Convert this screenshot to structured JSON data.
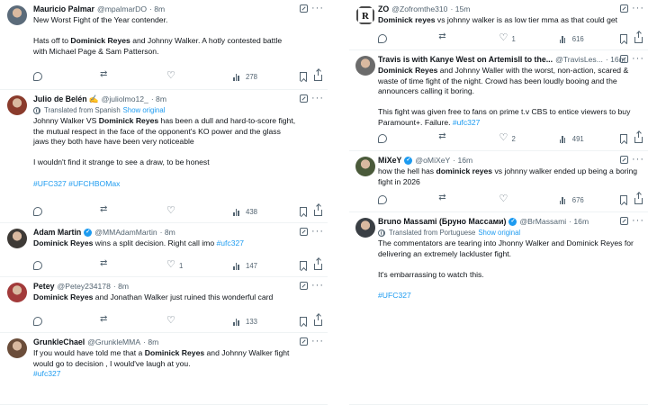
{
  "left": [
    {
      "name": "Mauricio Palmar",
      "handle": "@mpalmarDO",
      "time": "· 8m",
      "text_parts": [
        {
          "line": "New Worst Fight of the Year contender."
        },
        {
          "gap": true
        },
        {
          "segments": [
            {
              "t": "Hats off to "
            },
            {
              "b": "Dominick Reyes"
            },
            {
              "t": " and Johnny Walker. A hotly contested battle"
            }
          ]
        },
        {
          "line": "with Michael Page & Sam Patterson."
        }
      ],
      "views": "278"
    },
    {
      "name": "Julio de Belén",
      "name_emoji": "✍️",
      "handle": "@juliolmo12_",
      "time": "· 8m",
      "translated": "Translated from Spanish",
      "show_original": "Show original",
      "text_parts": [
        {
          "segments": [
            {
              "t": "Johnny Walker VS "
            },
            {
              "b": "Dominick Reyes"
            },
            {
              "t": " has been a dull and hard-to-score fight,"
            }
          ]
        },
        {
          "line": "the mutual respect in the face of the opponent's KO power and the glass"
        },
        {
          "line": "jaws they both have have been very noticeable"
        },
        {
          "gap": true
        },
        {
          "line": "I wouldn't find it strange to see a draw, to be honest"
        },
        {
          "gap": true
        },
        {
          "tags": "#UFC327 #UFCHBOMax"
        }
      ],
      "views": "438"
    },
    {
      "name": "Adam Martin",
      "verified": true,
      "handle": "@MMAdamMartin",
      "time": "· 8m",
      "text_parts": [
        {
          "segments": [
            {
              "b": "Dominick Reyes"
            },
            {
              "t": " wins a split decision. Right call imo "
            },
            {
              "tag": "#ufc327"
            }
          ]
        }
      ],
      "likes": "1",
      "views": "147"
    },
    {
      "name": "Petey",
      "handle": "@Petey234178",
      "time": "· 8m",
      "text_parts": [
        {
          "segments": [
            {
              "b": "Dominick Reyes"
            },
            {
              "t": " and Jonathan Walker just ruined this wonderful card"
            }
          ]
        }
      ],
      "views": "133"
    },
    {
      "name": "GrunkleChael",
      "handle": "@GrunkleMMA",
      "time": "· 8m",
      "text_parts": [
        {
          "segments": [
            {
              "t": "If you would have told me that a "
            },
            {
              "b": "Dominick Reyes"
            },
            {
              "t": " and Johnny Walker fight"
            }
          ]
        },
        {
          "line": "would go to decision , I would've  laugh at you."
        },
        {
          "tags": "#ufc327"
        }
      ]
    }
  ],
  "right": [
    {
      "name": "ZO",
      "handle": "@Zofromthe310",
      "time": "· 15m",
      "text_parts": [
        {
          "segments": [
            {
              "b": "Dominick reyes"
            },
            {
              "t": " vs johnny walker is as low tier mma as that could get"
            }
          ]
        }
      ],
      "likes": "1",
      "views": "616"
    },
    {
      "name": "Travis is with Kanye West on Artemisll to the...",
      "handle": "@TravisLes...",
      "time": "· 16m",
      "text_parts": [
        {
          "segments": [
            {
              "b": "Dominick Reyes"
            },
            {
              "t": " and Johnny Waller with the worst, non-action, scared &"
            }
          ]
        },
        {
          "line": "waste of time fight of the night. Crowd has been loudly booing and the"
        },
        {
          "line": "announcers calling it boring."
        },
        {
          "gap": true
        },
        {
          "line": "This fight was given free to fans on prime t.v CBS to entice viewers to buy"
        },
        {
          "segments": [
            {
              "t": "Paramount+. Failure. "
            },
            {
              "tag": "#ufc327"
            }
          ]
        }
      ],
      "likes": "2",
      "views": "491"
    },
    {
      "name": "MiXeY",
      "verified": true,
      "handle": "@oMiXeY",
      "time": "· 16m",
      "text_parts": [
        {
          "segments": [
            {
              "t": "how the hell has "
            },
            {
              "b": "dominick reyes"
            },
            {
              "t": " vs johnny walker ended up being a boring"
            }
          ]
        },
        {
          "line": "fight in 2026"
        }
      ],
      "views": "676"
    },
    {
      "name": "Bruno Massami (Бруно Массами)",
      "verified": true,
      "handle": "@BrMassami",
      "time": "· 16m",
      "translated": "Translated from Portuguese",
      "show_original": "Show original",
      "text_parts": [
        {
          "line": "The commentators are tearing into Jhonny Walker and Dominick Reyes for"
        },
        {
          "line": "delivering an extremely lackluster fight."
        },
        {
          "gap": true
        },
        {
          "line": "It's embarrassing to watch this."
        },
        {
          "gap": true
        },
        {
          "tags": "#UFC327"
        }
      ]
    }
  ],
  "colors": {
    "text": "#0f1419",
    "muted": "#536471",
    "link": "#1d9bf0",
    "divider": "#eff3f4"
  },
  "icons": [
    "reply-icon",
    "retweet-icon",
    "like-icon",
    "views-icon",
    "bookmark-icon",
    "share-icon",
    "more-icon",
    "grok-icon",
    "globe-icon",
    "verified-icon"
  ]
}
